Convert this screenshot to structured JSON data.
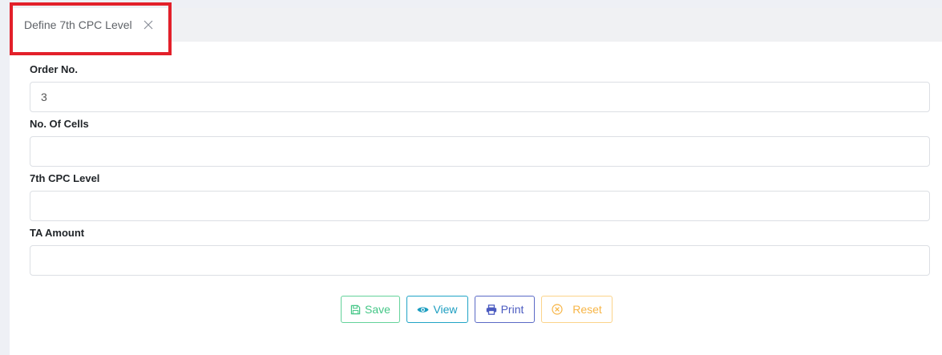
{
  "tab": {
    "label": "Define 7th CPC Level"
  },
  "form": {
    "fields": [
      {
        "label": "Order No.",
        "value": "3",
        "placeholder": ""
      },
      {
        "label": "No. Of Cells",
        "value": "",
        "placeholder": ""
      },
      {
        "label": "7th CPC Level",
        "value": "",
        "placeholder": ""
      },
      {
        "label": "TA Amount",
        "value": "",
        "placeholder": ""
      }
    ]
  },
  "buttons": {
    "save": {
      "label": "Save",
      "icon": "floppy-disk-icon",
      "color": "#45c787"
    },
    "view": {
      "label": "View",
      "icon": "eye-icon",
      "color": "#1b9dc0"
    },
    "print": {
      "label": "Print",
      "icon": "printer-icon",
      "color": "#4b5bc0"
    },
    "reset": {
      "label": "Reset",
      "icon": "circle-x-icon",
      "color": "#f7b546"
    }
  },
  "highlight": {
    "color": "#e3202a"
  }
}
